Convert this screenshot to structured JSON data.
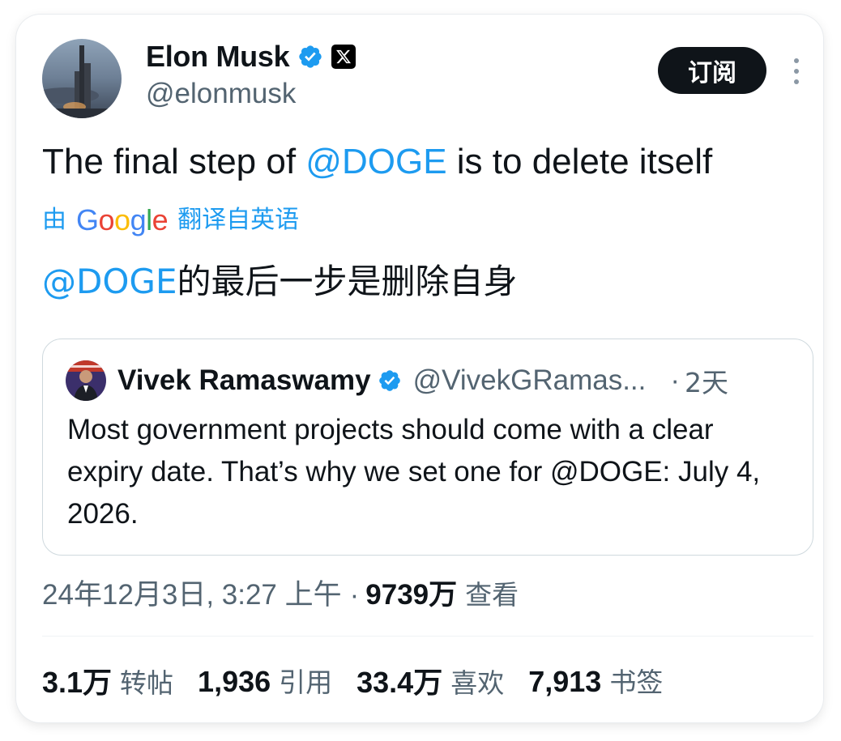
{
  "author": {
    "name": "Elon Musk",
    "handle": "@elonmusk",
    "verified": true,
    "badge_icon": "x-logo-icon"
  },
  "subscribe_label": "订阅",
  "more_icon": "more-vertical-icon",
  "tweet": {
    "text_before": "The final step of ",
    "mention": "@DOGE",
    "text_after": " is to delete itself"
  },
  "translation": {
    "prefix": "由",
    "google": "Google",
    "suffix": "翻译自英语",
    "mention": "@DOGE",
    "text": "的最后一步是删除自身"
  },
  "quoted_tweet": {
    "name": "Vivek Ramaswamy",
    "handle": "@VivekGRamas...",
    "separator": "·",
    "time": "2天",
    "text": "Most government projects should come with a clear expiry date. That’s why we set one for @DOGE: July 4, 2026."
  },
  "meta": {
    "timestamp": "24年12月3日, 3:27 上午",
    "separator": "·",
    "views": "9739万",
    "views_label": "查看"
  },
  "stats": [
    {
      "value": "3.1万",
      "label": "转帖"
    },
    {
      "value": "1,936",
      "label": "引用"
    },
    {
      "value": "33.4万",
      "label": "喜欢"
    },
    {
      "value": "7,913",
      "label": "书签"
    }
  ],
  "colors": {
    "accent": "#1d9bf0",
    "text": "#0f1419",
    "muted": "#536471"
  }
}
